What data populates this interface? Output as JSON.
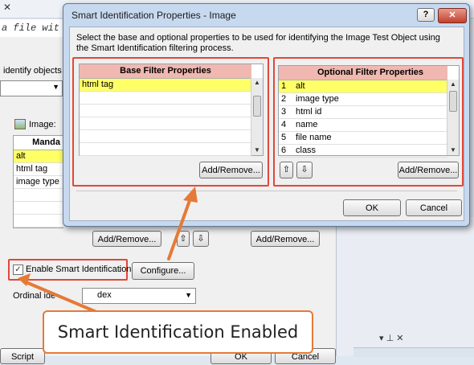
{
  "background": {
    "code_snippet": "a file wit",
    "identify_label": "identify objects c",
    "image_label": "Image:",
    "mandatory_header": "Manda",
    "mandatory_rows": [
      "alt",
      "html tag",
      "image type",
      "",
      "",
      ""
    ],
    "add_remove_left": "Add/Remove...",
    "add_remove_right": "Add/Remove...",
    "enable_smart_id_label": "Enable Smart Identification",
    "enable_smart_id_checked": true,
    "configure_button": "Configure...",
    "ordinal_label": "Ordinal ide",
    "ordinal_value": "dex",
    "bottom_left_button": "Script",
    "bottom_right_button": "OK",
    "bottom_far_button": "Cancel"
  },
  "dialog": {
    "title": "Smart Identification Properties - Image",
    "description": "Select the base and optional properties to be used for identifying the Image Test Object using the Smart Identification filtering process.",
    "base": {
      "header": "Base Filter Properties",
      "rows": [
        "html tag",
        "",
        "",
        "",
        "",
        "",
        ""
      ],
      "add_remove": "Add/Remove..."
    },
    "optional": {
      "header": "Optional Filter Properties",
      "rows": [
        {
          "n": "1",
          "v": "alt"
        },
        {
          "n": "2",
          "v": "image type"
        },
        {
          "n": "3",
          "v": "html id"
        },
        {
          "n": "4",
          "v": "name"
        },
        {
          "n": "5",
          "v": "file name"
        },
        {
          "n": "6",
          "v": "class"
        }
      ],
      "add_remove": "Add/Remove..."
    },
    "ok": "OK",
    "cancel": "Cancel",
    "help": "?"
  },
  "callout": {
    "text": "Smart Identification Enabled"
  },
  "colors": {
    "highlight_red": "#e0483a",
    "selected_row": "#ffff66",
    "grid_header": "#f0b8b0",
    "arrow_orange": "#e57a36"
  }
}
